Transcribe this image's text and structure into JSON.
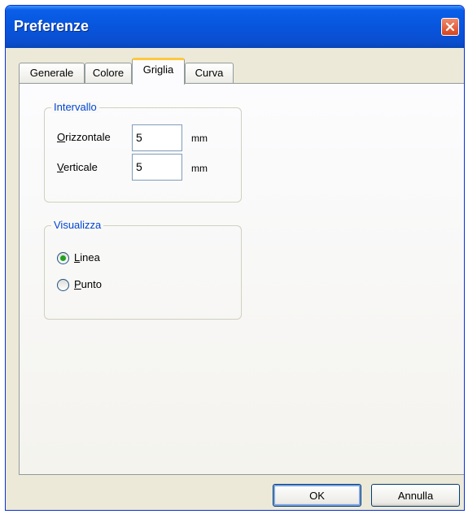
{
  "window": {
    "title": "Preferenze"
  },
  "tabs": [
    {
      "label": "Generale"
    },
    {
      "label": "Colore"
    },
    {
      "label": "Griglia",
      "active": true
    },
    {
      "label": "Curva"
    }
  ],
  "intervallo": {
    "legend": "Intervallo",
    "orizzontale": {
      "label_first": "O",
      "label_rest": "rizzontale",
      "value": "5",
      "unit": "mm"
    },
    "verticale": {
      "label_first": "V",
      "label_rest": "erticale",
      "value": "5",
      "unit": "mm"
    }
  },
  "visualizza": {
    "legend": "Visualizza",
    "options": [
      {
        "label_first": "L",
        "label_rest": "inea",
        "selected": true
      },
      {
        "label_first": "P",
        "label_rest": "unto",
        "selected": false
      }
    ]
  },
  "buttons": {
    "ok": "OK",
    "cancel": "Annulla"
  },
  "colors": {
    "titlebar": "#0855dd",
    "accent_tab": "#ffc83c",
    "group_legend": "#0046d5"
  },
  "icons": {
    "close": "close-icon",
    "radio_selected": "radio-selected-icon"
  }
}
